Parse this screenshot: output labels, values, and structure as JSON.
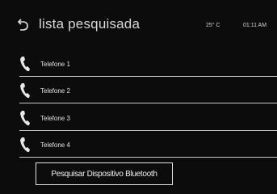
{
  "header": {
    "back_icon": "back-arrow-icon",
    "title": "lista pesquisada",
    "temperature": "25° C",
    "time": "01:11 AM"
  },
  "phones": [
    {
      "label": "Telefone 1",
      "icon": "phone-handset-icon"
    },
    {
      "label": "Telefone 2",
      "icon": "phone-handset-icon"
    },
    {
      "label": "Telefone 3",
      "icon": "phone-handset-icon"
    },
    {
      "label": "Telefone 4",
      "icon": "phone-handset-icon"
    }
  ],
  "actions": {
    "search_bluetooth_label": "Pesquisar Dispositivo Bluetooth"
  },
  "colors": {
    "background": "#0c0c0c",
    "text": "#e0e0e0",
    "divider": "#c8c8c8"
  }
}
